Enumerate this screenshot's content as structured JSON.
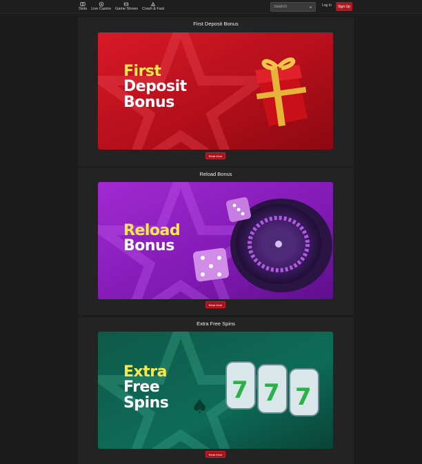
{
  "nav": {
    "items": [
      {
        "label": "Slots",
        "icon": "slots-icon"
      },
      {
        "label": "Live Casino",
        "icon": "live-casino-icon"
      },
      {
        "label": "Game Shows",
        "icon": "game-shows-icon"
      },
      {
        "label": "Crash & Fast",
        "icon": "crash-fast-icon"
      }
    ]
  },
  "search": {
    "placeholder": "Search"
  },
  "auth": {
    "login_label": "Log In",
    "signup_label": "Sign Up"
  },
  "promos": [
    {
      "title": "First Deposit Bonus",
      "banner_lines": [
        "First",
        "Deposit",
        "Bonus"
      ],
      "button_label": "Read More",
      "accent_color": "#c8151f"
    },
    {
      "title": "Reload Bonus",
      "banner_lines": [
        "Reload",
        "Bonus"
      ],
      "button_label": "Read More",
      "accent_color": "#8a1fc2"
    },
    {
      "title": "Extra Free Spins",
      "banner_lines": [
        "Extra",
        "Free",
        "Spins"
      ],
      "button_label": "Read More",
      "accent_color": "#0f6b55"
    }
  ],
  "colors": {
    "background": "#1b1b1b",
    "card": "#232323",
    "signup": "#b01820",
    "highlight_text": "#f7e94a"
  }
}
